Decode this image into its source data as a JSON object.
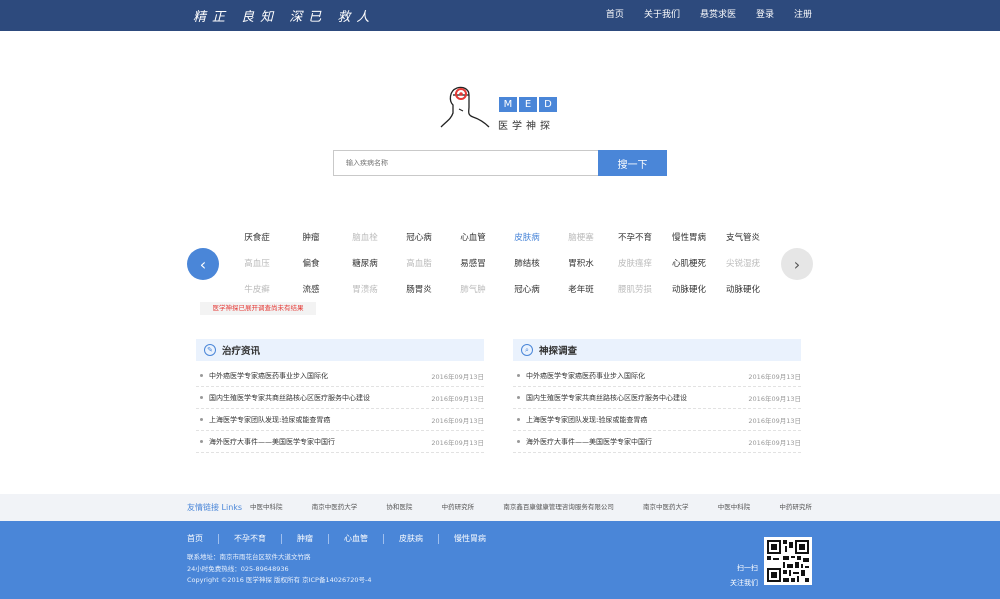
{
  "header": {
    "slogan": "精正 良知 深已 救人",
    "nav": [
      "首页",
      "关于我们",
      "悬赏求医",
      "登录",
      "注册"
    ]
  },
  "logo": {
    "letters": [
      "M",
      "E",
      "D"
    ],
    "subtitle": "医学神探"
  },
  "search": {
    "placeholder": "输入疾病名称",
    "button_label": "搜一下"
  },
  "tags": {
    "rows": [
      [
        {
          "t": "厌食症",
          "s": "normal"
        },
        {
          "t": "肿瘤",
          "s": "normal"
        },
        {
          "t": "脑血栓",
          "s": "dim"
        },
        {
          "t": "冠心病",
          "s": "normal"
        },
        {
          "t": "心血管",
          "s": "normal"
        },
        {
          "t": "皮肤病",
          "s": "active"
        },
        {
          "t": "脑梗塞",
          "s": "dim"
        },
        {
          "t": "不孕不育",
          "s": "normal"
        },
        {
          "t": "慢性胃病",
          "s": "normal"
        },
        {
          "t": "支气管炎",
          "s": "normal"
        }
      ],
      [
        {
          "t": "高血压",
          "s": "dim"
        },
        {
          "t": "偏食",
          "s": "normal"
        },
        {
          "t": "糖尿病",
          "s": "normal"
        },
        {
          "t": "高血脂",
          "s": "dim"
        },
        {
          "t": "易感冒",
          "s": "normal"
        },
        {
          "t": "肺结核",
          "s": "normal"
        },
        {
          "t": "胃积水",
          "s": "normal"
        },
        {
          "t": "皮肤瘙痒",
          "s": "dim"
        },
        {
          "t": "心肌梗死",
          "s": "normal"
        },
        {
          "t": "尖锐湿疣",
          "s": "dim"
        }
      ],
      [
        {
          "t": "牛皮癣",
          "s": "dim"
        },
        {
          "t": "流感",
          "s": "normal"
        },
        {
          "t": "胃溃疡",
          "s": "dim"
        },
        {
          "t": "肠胃炎",
          "s": "normal"
        },
        {
          "t": "肺气肿",
          "s": "dim"
        },
        {
          "t": "冠心病",
          "s": "normal"
        },
        {
          "t": "老年斑",
          "s": "normal"
        },
        {
          "t": "腰肌劳损",
          "s": "dim"
        },
        {
          "t": "动脉硬化",
          "s": "normal"
        },
        {
          "t": "动脉硬化",
          "s": "normal"
        }
      ]
    ],
    "notice": "医学神探已展开调查尚未有结果"
  },
  "panels": [
    {
      "title": "治疗资讯",
      "icon": "pen-icon",
      "items": [
        {
          "title": "中外癌医学专家癌医药事业步入国际化",
          "date": "2016年09月13日"
        },
        {
          "title": "国内生殖医学专家共商丝路核心区医疗服务中心建设",
          "date": "2016年09月13日"
        },
        {
          "title": "上海医学专家团队发现:验尿或能查胃癌",
          "date": "2016年09月13日"
        },
        {
          "title": "海外医疗大事件——美国医学专家中国行",
          "date": "2016年09月13日"
        }
      ]
    },
    {
      "title": "神探调查",
      "icon": "magnifier-icon",
      "items": [
        {
          "title": "中外癌医学专家癌医药事业步入国际化",
          "date": "2016年09月13日"
        },
        {
          "title": "国内生殖医学专家共商丝路核心区医疗服务中心建设",
          "date": "2016年09月13日"
        },
        {
          "title": "上海医学专家团队发现:验尿或能查胃癌",
          "date": "2016年09月13日"
        },
        {
          "title": "海外医疗大事件——美国医学专家中国行",
          "date": "2016年09月13日"
        }
      ]
    }
  ],
  "links": {
    "title": "友情链接 Links",
    "items": [
      "中医中科院",
      "南京中医药大学",
      "协和医院",
      "中药研究所",
      "南京鑫百康健康管理咨询服务有限公司",
      "南京中医药大学",
      "中医中科院",
      "中药研究所"
    ]
  },
  "footer": {
    "nav": [
      "首页",
      "不孕不育",
      "肿瘤",
      "心血管",
      "皮肤病",
      "慢性胃病"
    ],
    "address": "联系地址：南京市雨花台区软件大道文竹路",
    "hotline": "24小时免费热线：025-89648936",
    "copyright": "Copyright ©2016 医学神探 版权所有 京ICP备14026720号-4",
    "qr_label_1": "扫一扫",
    "qr_label_2": "关注我们"
  },
  "colors": {
    "topbar": "#2d4a7d",
    "accent": "#4a86d8",
    "footer": "#4a86d8"
  }
}
